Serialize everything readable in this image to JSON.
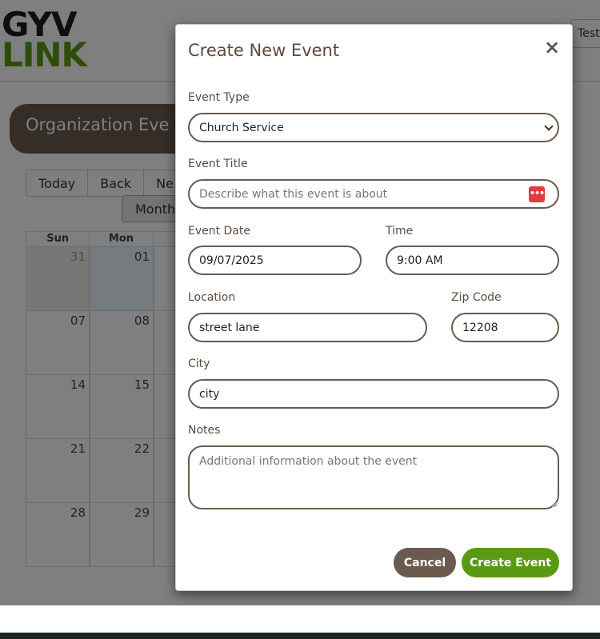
{
  "header": {
    "logo_top": "GYV",
    "logo_bottom": "LINK",
    "user_label": "Test"
  },
  "banner": {
    "title": "Organization Eve"
  },
  "calendar": {
    "toolbar": [
      "Today",
      "Back",
      "Ne"
    ],
    "view_label": "Month",
    "weekdays": [
      "Sun",
      "Mon"
    ],
    "weeks": [
      [
        "31",
        "01"
      ],
      [
        "07",
        "08"
      ],
      [
        "14",
        "15"
      ],
      [
        "21",
        "22"
      ],
      [
        "28",
        "29"
      ]
    ]
  },
  "modal": {
    "title": "Create New Event",
    "close_symbol": "×",
    "event_type": {
      "label": "Event Type",
      "value": "Church Service",
      "options": [
        "Church Service"
      ]
    },
    "event_title": {
      "label": "Event Title",
      "placeholder": "Describe what this event is about",
      "icon": "password-manager-icon"
    },
    "event_date": {
      "label": "Event Date",
      "value": "09/07/2025"
    },
    "time": {
      "label": "Time",
      "value": "9:00 AM"
    },
    "location": {
      "label": "Location",
      "value": "street lane"
    },
    "zip": {
      "label": "Zip Code",
      "value": "12208"
    },
    "city": {
      "label": "City",
      "value": "city"
    },
    "notes": {
      "label": "Notes",
      "placeholder": "Additional information about the event"
    },
    "cancel_label": "Cancel",
    "create_label": "Create Event"
  },
  "colors": {
    "brand_brown": "#6b5a4e",
    "brand_green": "#5a9a12",
    "title_text": "#5c4a3f"
  }
}
